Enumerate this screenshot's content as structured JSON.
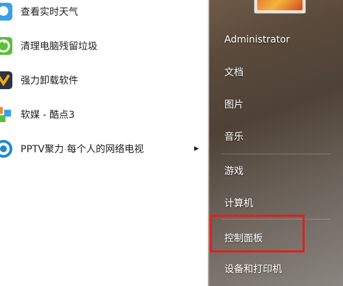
{
  "programs": [
    {
      "label": "查看实时天气",
      "icon": "weather-icon"
    },
    {
      "label": "清理电脑残留垃圾",
      "icon": "recycle-icon"
    },
    {
      "label": "强力卸载软件",
      "icon": "uninstall-icon"
    },
    {
      "label": "软媒 - 酷点3",
      "icon": "cubes-icon"
    },
    {
      "label": "PPTV聚力 每个人的网络电视",
      "icon": "pptv-icon",
      "has_submenu": true
    }
  ],
  "places": {
    "user": "Administrator",
    "items": [
      "文档",
      "图片",
      "音乐",
      "游戏",
      "计算机",
      "控制面板",
      "设备和打印机"
    ]
  },
  "colors": {
    "highlight_box": "#e1201c",
    "places_text": "#ffffff"
  }
}
